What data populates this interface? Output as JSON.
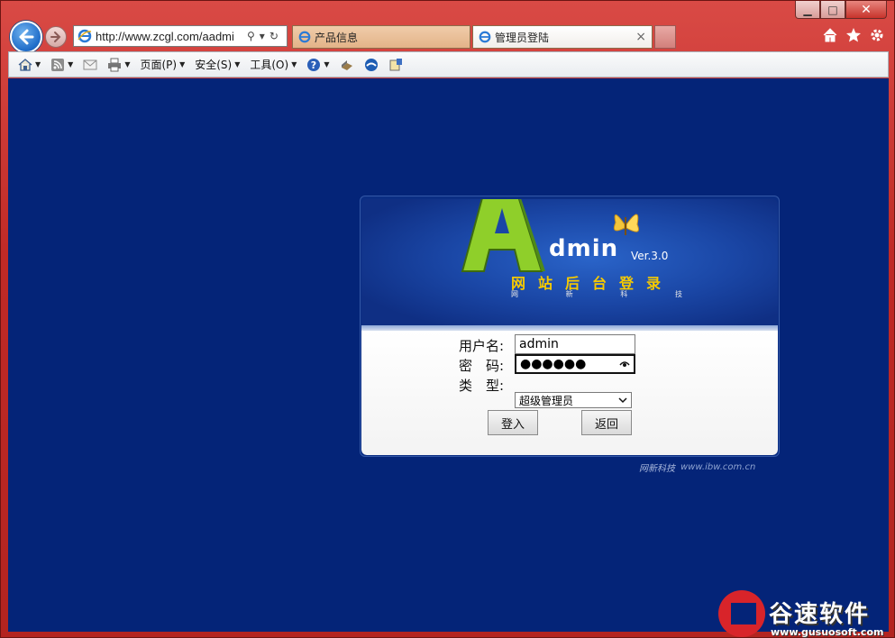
{
  "window": {
    "minimize_glyph": "▁",
    "maximize_glyph": "□",
    "close_glyph": "✕"
  },
  "address": {
    "url": "http://www.zcgl.com/aadmi",
    "search_glyph": "⚲",
    "dropdown_glyph": "▾",
    "refresh_glyph": "↻"
  },
  "tabs": [
    {
      "label": "产品信息"
    },
    {
      "label": "管理员登陆",
      "close_glyph": "×"
    }
  ],
  "commandbar": {
    "page_label": "页面(P)",
    "safety_label": "安全(S)",
    "tools_label": "工具(O)"
  },
  "login": {
    "version": "Ver.3.0",
    "brand_word": "dmin",
    "slogan": "网站后台登录",
    "sub_chars": [
      "网",
      "新",
      "科",
      "技"
    ],
    "username_label": "用户名:",
    "password_label": "密　码:",
    "type_label": "类　型:",
    "username_value": "admin",
    "password_value": "●●●●●●",
    "type_value": "超级管理员",
    "login_button": "登入",
    "back_button": "返回"
  },
  "footer": {
    "company_logo": "网新科技",
    "url": "www.ibw.com.cn"
  },
  "watermark": {
    "name": "谷速软件",
    "url": "www.gusuosoft.com"
  },
  "colors": {
    "page_bg": "#042478",
    "frame": "#c9302c",
    "slogan": "#f6c900"
  }
}
